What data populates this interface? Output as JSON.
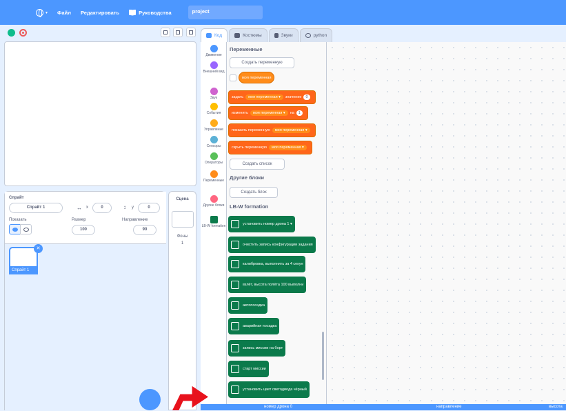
{
  "menu": {
    "file": "Файл",
    "edit": "Редактировать",
    "tutorials": "Руководства",
    "project_title": "project"
  },
  "tabs": [
    {
      "label": "Код"
    },
    {
      "label": "Костюмы"
    },
    {
      "label": "Звуки"
    },
    {
      "label": "python"
    }
  ],
  "categories": [
    {
      "label": "Движение",
      "color": "#4c97ff"
    },
    {
      "label": "Внешний вид",
      "color": "#9966ff"
    },
    {
      "label": "Звук",
      "color": "#cf63cf"
    },
    {
      "label": "События",
      "color": "#ffbf00"
    },
    {
      "label": "Управление",
      "color": "#ffab19"
    },
    {
      "label": "Сенсоры",
      "color": "#5cb1d6"
    },
    {
      "label": "Операторы",
      "color": "#59c059"
    },
    {
      "label": "Переменные",
      "color": "#ff8c1a"
    },
    {
      "label": "Другие блоки",
      "color": "#ff6680"
    },
    {
      "label": "LB-W formation",
      "color": "#0b7a4b"
    }
  ],
  "palette": {
    "variables_header": "Переменные",
    "create_variable": "Создать переменную",
    "my_variable": "моя переменная",
    "set_block": {
      "prefix": "задать",
      "var": "моя переменная",
      "mid": "значение",
      "value": "0"
    },
    "change_block": {
      "prefix": "изменить",
      "var": "моя переменная",
      "mid": "на",
      "value": "1"
    },
    "show_block": {
      "prefix": "показать переменную",
      "var": "моя переменная"
    },
    "hide_block": {
      "prefix": "скрыть переменную",
      "var": "моя переменная"
    },
    "create_list": "Создать список",
    "other_header": "Другие блоки",
    "create_block": "Создать блок",
    "lbw_header": "LB-W formation",
    "lbw_blocks": [
      "установить номер дрона  1 ▾",
      "очистить запись конфигурации задания",
      "калибровка, выполнить за  4  секун",
      "взлёт, высота полёта  100  выполни",
      "автопосадка",
      "аварийная посадка",
      "запись миссии на борт",
      "старт миссии",
      "установить цвет светодиода  чёрный"
    ]
  },
  "sprite_info": {
    "sprite_label": "Спрайт",
    "sprite_name": "Спрайт 1",
    "x_label": "x",
    "x_value": "0",
    "y_label": "y",
    "y_value": "0",
    "show_label": "Показать",
    "size_label": "Размер",
    "size_value": "100",
    "direction_label": "Направление",
    "direction_value": "90"
  },
  "sprites": [
    {
      "name": "Спрайт 1"
    }
  ],
  "stage_panel": {
    "title": "Сцена",
    "backdrops_label": "Фоны",
    "backdrops_count": "1"
  },
  "bottom_bar": {
    "drone_number": "номер дрона 0",
    "direction": "направление",
    "height": "высота"
  },
  "colors": {
    "menu_bar": "#4c97ff",
    "variables": "#ff8c1a",
    "lbw": "#0b7a4b"
  }
}
